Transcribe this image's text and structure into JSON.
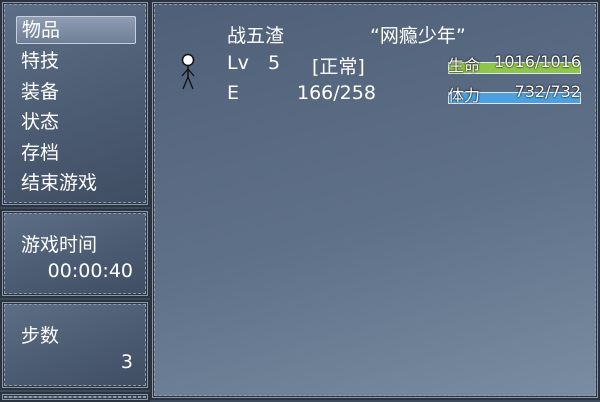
{
  "menu": {
    "items": [
      {
        "label": "物品",
        "selected": true
      },
      {
        "label": "特技",
        "selected": false
      },
      {
        "label": "装备",
        "selected": false
      },
      {
        "label": "状态",
        "selected": false
      },
      {
        "label": "存档",
        "selected": false
      },
      {
        "label": "结束游戏",
        "selected": false
      }
    ]
  },
  "playtime": {
    "label": "游戏时间",
    "value": "00:00:40"
  },
  "steps": {
    "label": "步数",
    "value": "3"
  },
  "character": {
    "name": "战五渣",
    "title": "“网瘾少年”",
    "level_label": "Lv",
    "level": "5",
    "state": "[正常]",
    "exp_label": "E",
    "exp": "166/258",
    "hp_label": "生命",
    "hp": "1016/1016",
    "hp_fraction": 1.0,
    "sp_label": "体力",
    "sp": "732/732",
    "sp_fraction": 1.0
  },
  "colors": {
    "hp_fill": "#8fc64a",
    "sp_fill": "#4aa0e0"
  }
}
